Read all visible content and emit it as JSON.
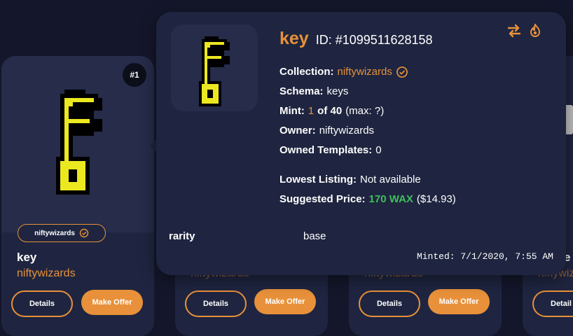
{
  "background_color": "#14172b",
  "accent_color": "#e8913a",
  "main_card": {
    "rank": "#1",
    "collection_pill": "niftywizards",
    "name": "key",
    "collection": "niftywizards",
    "details_label": "Details",
    "offer_label": "Make Offer"
  },
  "other_cards": [
    {
      "collection": "niftywizards",
      "details_label": "Details",
      "offer_label": "Make Offer"
    },
    {
      "collection": "niftywizards",
      "details_label": "Details",
      "offer_label": "Make Offer"
    },
    {
      "collection": "niftywizards",
      "name": "e",
      "details_label": "Detail"
    }
  ],
  "popup": {
    "name": "key",
    "id_text": "ID: #1099511628158",
    "collection_label": "Collection:",
    "collection_value": "niftywizards",
    "schema_label": "Schema:",
    "schema_value": "keys",
    "mint_label": "Mint:",
    "mint_number": "1",
    "mint_of": "of 40",
    "mint_max": "(max: ?)",
    "owner_label": "Owner:",
    "owner_value": "niftywizards",
    "owned_templates_label": "Owned Templates:",
    "owned_templates_value": "0",
    "lowest_listing_label": "Lowest Listing:",
    "lowest_listing_value": "Not available",
    "suggested_price_label": "Suggested Price:",
    "suggested_price_wax": "170 WAX",
    "suggested_price_usd": "($14.93)",
    "attribute_key": "rarity",
    "attribute_value": "base",
    "minted": "Minted: 7/1/2020, 7:55 AM",
    "icons": [
      "transfer-icon",
      "burn-icon"
    ]
  }
}
